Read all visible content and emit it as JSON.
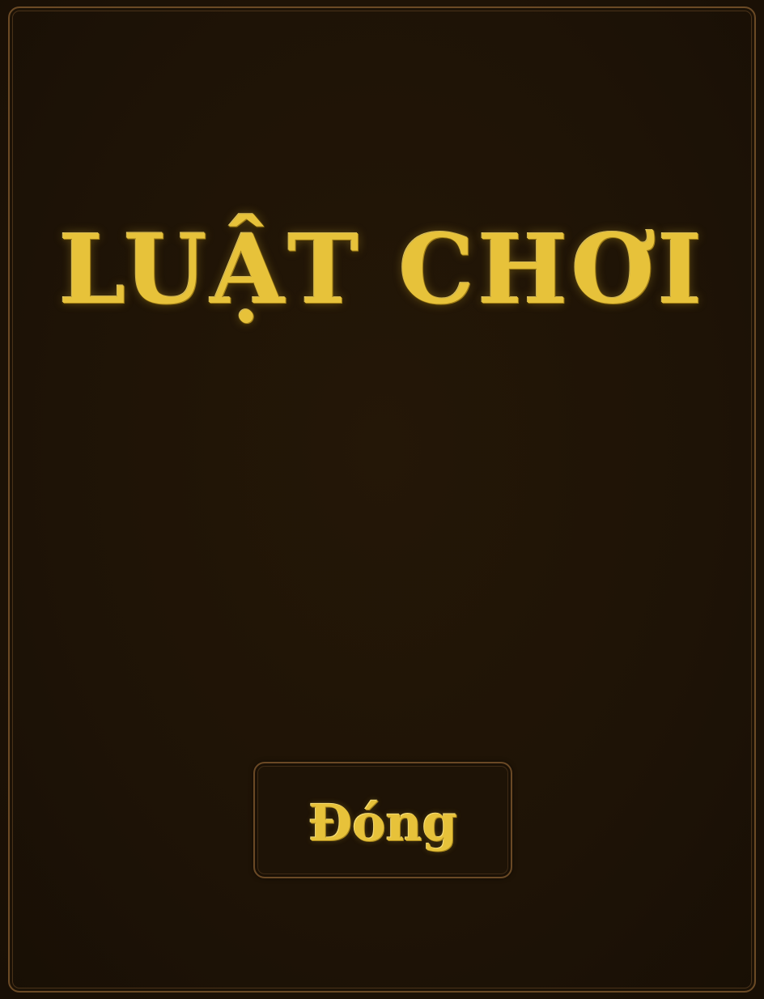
{
  "dialog": {
    "title": "LUẬT CHƠI",
    "body_text": "",
    "close_button_label": "Đóng"
  },
  "colors": {
    "background": "#1e1306",
    "gold_text": "#e7c23a",
    "border": "#6b4a25"
  }
}
